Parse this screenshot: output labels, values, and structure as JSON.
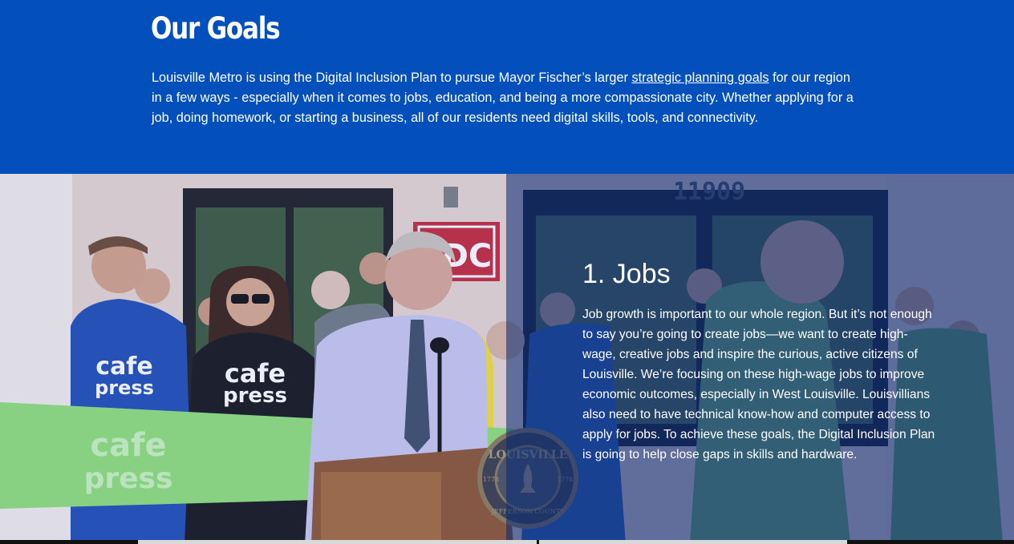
{
  "goals": {
    "title": "Our Goals",
    "text_before_link": "Louisville Metro is using the Digital Inclusion Plan to pursue Mayor Fischer’s larger ",
    "link_label": "strategic planning goals",
    "text_after_link": " for our region in a few ways - especially when it comes to jobs, education, and being a more compassionate city. Whether applying for a job, doing homework, or starting a business, all of our residents need digital skills, tools, and connectivity."
  },
  "jobs": {
    "title": "1. Jobs",
    "text": "Job growth is important to our whole region. But it’s not enough to say you’re going to create jobs—we want to create high-wage, creative jobs and inspire the curious, active citizens of Louisville. We’re focusing on these high-wage jobs to improve economic outcomes, especially in West Louisville. Louisvillians also need to have technical know-how and computer access to apply for jobs. To achieve these goals, the Digital Inclusion Plan is going to help close gaps in skills and hardware."
  },
  "photo": {
    "building_number": "11909",
    "sign_text": "DC",
    "shirt_text_top": "cafe",
    "shirt_text_bottom": "press",
    "seal_text_top": "LOUISVILLE",
    "seal_text_bottom": "JEFFERSON COUNTY",
    "seal_year_left": "1778",
    "seal_year_right": "1778"
  },
  "colors": {
    "header_blue": "#0350bd",
    "overlay_blue": "#0e2e7a"
  }
}
